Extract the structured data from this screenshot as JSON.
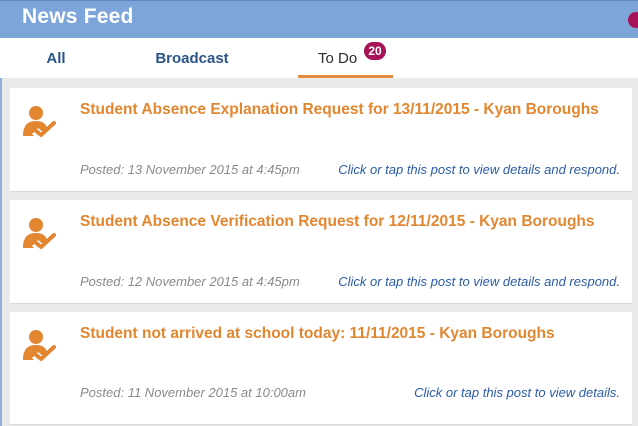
{
  "header": {
    "title": "News Feed"
  },
  "tabs": [
    {
      "label": "All"
    },
    {
      "label": "Broadcast"
    },
    {
      "label": "To Do",
      "count": "20"
    }
  ],
  "feed": {
    "items": [
      {
        "title": "Student Absence Explanation Request for 13/11/2015 - Kyan Boroughs",
        "posted": "Posted: 13 November 2015 at 4:45pm",
        "action": "Click or tap this post to view details and respond.",
        "icon": "student-check-icon"
      },
      {
        "title": "Student Absence Verification Request for 12/11/2015 - Kyan Boroughs",
        "posted": "Posted: 12 November 2015 at 4:45pm",
        "action": "Click or tap this post to view details and respond.",
        "icon": "student-check-icon"
      },
      {
        "title": "Student not arrived at school today: 11/11/2015 - Kyan Boroughs",
        "posted": "Posted: 11 November 2015 at 10:00am",
        "action": "Click or tap this post to view details.",
        "icon": "student-check-icon"
      }
    ]
  },
  "colors": {
    "header": "#7ea5da",
    "accent_orange": "#e2862f",
    "badge": "#a61357",
    "link_blue": "#2b5ba8"
  }
}
